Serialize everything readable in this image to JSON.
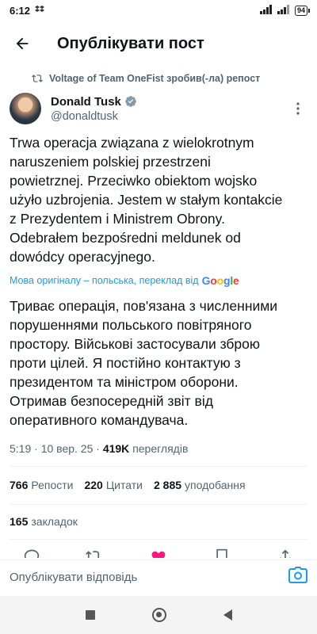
{
  "status_bar": {
    "time": "6:12",
    "battery": "94"
  },
  "header": {
    "title": "Опублікувати пост"
  },
  "repost": {
    "text": "Voltage of Team OneFist зробив(-ла) репост"
  },
  "author": {
    "name": "Donald Tusk",
    "handle": "@donaldtusk"
  },
  "tweet": {
    "lines": [
      "Trwa operacja związana z wielokrotnym",
      "naruszeniem polskiej przestrzeni",
      "powietrznej. Przeciwko obiektom wojsko",
      "użyło uzbrojenia. Jestem w stałym kontakcie",
      "z Prezydentem i Ministrem Obrony.",
      "Odebrałem bezpośredni meldunek od",
      "dowódcy operacyjnego."
    ],
    "translate_note": "Мова оригіналу – польська, переклад від",
    "google": [
      "G",
      "o",
      "o",
      "g",
      "l",
      "e"
    ],
    "translated_lines": [
      "Триває операція, пов'язана з численними",
      "порушеннями польського повітряного",
      "простору. Військові застосували зброю",
      "проти цілей. Я постійно контактую з",
      "президентом та міністром оборони.",
      "Отримав безпосередній звіт від",
      "оперативного командувача."
    ]
  },
  "meta": {
    "time": "5:19",
    "sep1": "·",
    "date": "10 вер. 25",
    "sep2": "·",
    "views_count": "419K",
    "views_label": "переглядів"
  },
  "stats": {
    "reposts_count": "766",
    "reposts_label": "Репости",
    "quotes_count": "220",
    "quotes_label": "Цитати",
    "likes_count": "2 885",
    "likes_label": "уподобання"
  },
  "bookmarks": {
    "count": "165",
    "label": "закладок"
  },
  "reply": {
    "placeholder": "Опублікувати відповідь"
  },
  "colors": {
    "accent": "#1d9bf0",
    "like": "#f91880",
    "text": "#0f1419",
    "muted": "#536471"
  }
}
